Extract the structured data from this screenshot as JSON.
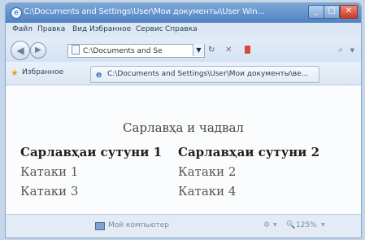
{
  "window": {
    "title": "C:\\Documents and Settings\\User\\Мои документы\\User Win...",
    "minimize": "_",
    "maximize": "□",
    "close": "✕"
  },
  "menu": {
    "items": [
      "Файл",
      "Правка",
      "Вид",
      "Избранное",
      "Сервис",
      "Справка"
    ]
  },
  "address": {
    "value": "C:\\Documents and Se",
    "dropdown_icon": "▼",
    "refresh_icon": "↻",
    "stop_icon": "✕",
    "search_icon": "⌕",
    "search_dropdown_icon": "▼"
  },
  "favorites": {
    "label": "Избранное",
    "star_icon": "★",
    "tab_icon": "e",
    "tab_title": "C:\\Documents and Settings\\User\\Мои документы\\ве..."
  },
  "page": {
    "caption": "Сарлавҳа и чадвал",
    "table": {
      "headers": [
        "Сарлавҳаи сутуни 1",
        "Сарлавҳаи сутуни 2"
      ],
      "rows": [
        [
          "Катаки 1",
          "Катаки 2"
        ],
        [
          "Катаки 3",
          "Катаки 4"
        ]
      ]
    }
  },
  "status": {
    "zone": "Мой компьютер",
    "settings_icon": "⚙",
    "zoom_icon": "🔍",
    "zoom": "125%",
    "dropdown_icon": "▼"
  },
  "colors": {
    "titlebar": "#4f83c2",
    "content_bg": "#fbfcfe",
    "close_button": "#c83b25"
  }
}
